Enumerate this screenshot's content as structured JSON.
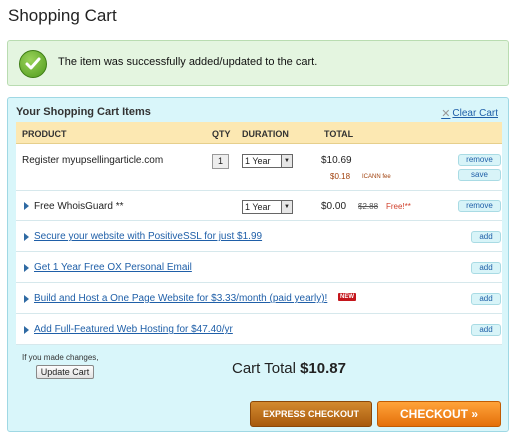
{
  "page": {
    "title": "Shopping Cart"
  },
  "notice": {
    "message": "The item was successfully added/updated to the cart."
  },
  "cart": {
    "header": "Your Shopping Cart Items",
    "clear_label": "Clear Cart",
    "columns": {
      "product": "PRODUCT",
      "qty": "QTY",
      "duration": "DURATION",
      "total": "TOTAL"
    },
    "items": [
      {
        "product": "Register myupsellingarticle.com",
        "qty": "1",
        "duration": "1 Year",
        "total": "$10.69",
        "fee_amount": "$0.18",
        "fee_label": "ICANN fee",
        "remove_label": "remove",
        "save_label": "save"
      },
      {
        "product": "Free WhoisGuard **",
        "duration": "1 Year",
        "total": "$0.00",
        "original_price": "$2.88",
        "free_label": "Free!**",
        "remove_label": "remove"
      }
    ],
    "offers": [
      {
        "text": "Secure your website with PositiveSSL for just $1.99",
        "action": "add"
      },
      {
        "text": "Get 1 Year Free OX Personal Email",
        "action": "add"
      },
      {
        "text": "Build and Host a One Page Website for $3.33/month (paid yearly)!",
        "badge": "NEW",
        "action": "add"
      },
      {
        "text": "Add Full-Featured Web Hosting for $47.40/yr",
        "action": "add"
      }
    ],
    "changes_note": "If you made changes,",
    "update_label": "Update Cart",
    "total_label": "Cart Total",
    "total_value": "$10.87"
  },
  "buttons": {
    "express": "EXPRESS CHECKOUT",
    "checkout": "CHECKOUT »"
  },
  "colors": {
    "panel_bg": "#d9f6fa",
    "header_bg": "#fce8b2",
    "checkout": "#ff8c1a",
    "express": "#b8661b",
    "success_bg": "#e4f5e0"
  }
}
